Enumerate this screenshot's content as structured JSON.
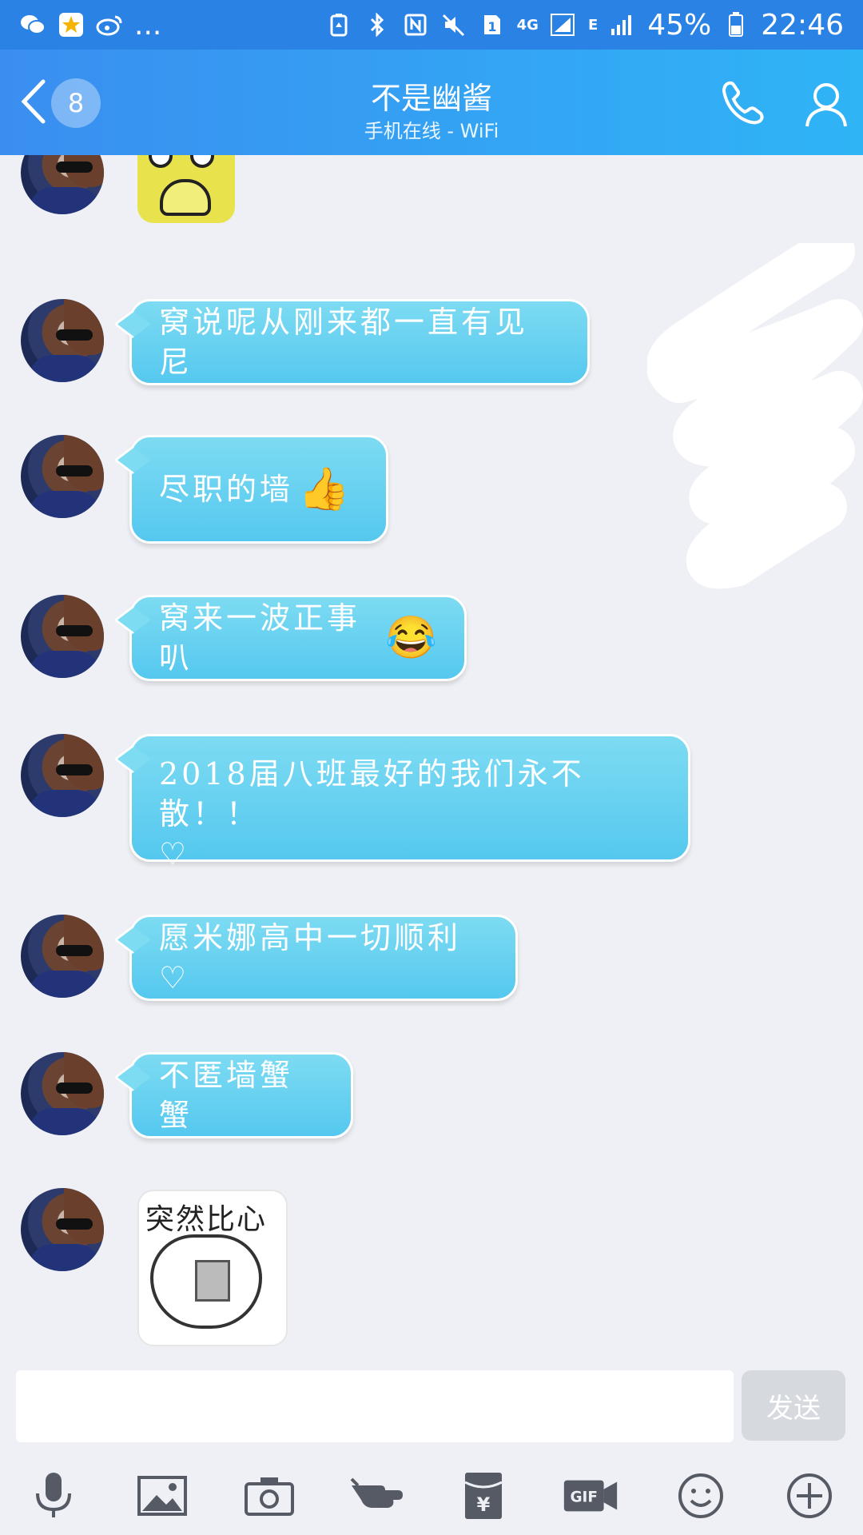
{
  "status_bar": {
    "battery_percent": "45%",
    "time": "22:46",
    "network_4g": "4G",
    "network_e": "E",
    "sim_slot": "1",
    "more": "..."
  },
  "header": {
    "back_badge": "8",
    "title": "不是幽酱",
    "subtitle": "手机在线 - WiFi"
  },
  "messages": [
    {
      "type": "sticker",
      "sticker_name": "shocked-yellow-dog-sticker"
    },
    {
      "type": "text",
      "text": "窝说呢从刚来都一直有见尼",
      "emoji": ""
    },
    {
      "type": "text",
      "text": "尽职的墙",
      "emoji": "👍"
    },
    {
      "type": "text",
      "text": "窝来一波正事叭",
      "emoji": "😂"
    },
    {
      "type": "text",
      "text": "2018届八班最好的我们永不散！！",
      "text2": "♡",
      "emoji": ""
    },
    {
      "type": "text",
      "text": "愿米娜高中一切顺利♡",
      "emoji": ""
    },
    {
      "type": "text",
      "text": "不匿墙蟹蟹",
      "emoji": ""
    },
    {
      "type": "sticker",
      "sticker_name": "heart-sticker",
      "caption": "突然比心"
    }
  ],
  "input": {
    "placeholder": "",
    "value": "",
    "send_label": "发送"
  },
  "toolbar": {
    "items": [
      "microphone-icon",
      "image-icon",
      "camera-icon",
      "poke-hand-icon",
      "red-packet-icon",
      "gif-icon",
      "emoji-icon",
      "plus-icon"
    ],
    "gif_label": "GIF",
    "redpacket_label": "¥"
  },
  "colors": {
    "title_bar_start": "#3a8ef0",
    "title_bar_end": "#2fb4f6",
    "bubble": "#5ccbef",
    "background": "#eef0f5"
  }
}
